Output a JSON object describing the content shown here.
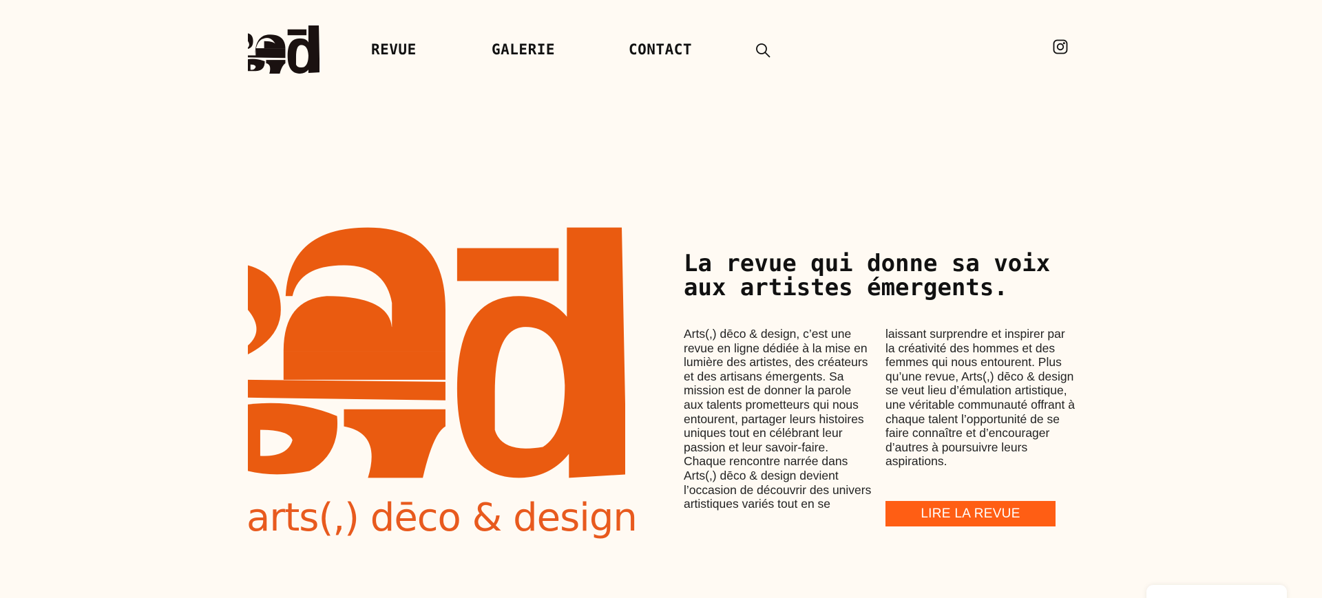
{
  "header": {
    "nav": [
      {
        "label": "REVUE"
      },
      {
        "label": "GALERIE"
      },
      {
        "label": "CONTACT"
      }
    ],
    "icons": {
      "search": "search-icon",
      "social": "instagram-icon"
    }
  },
  "hero": {
    "brand_name": "arts(,) dēco & design",
    "headline": "La revue qui donne sa voix aux artistes émergents.",
    "body_col1": "Arts(,) dēco & design, c’est une revue en ligne dédiée à la mise en lumière des artistes, des créateurs et des artisans émergents. Sa mission est de donner la parole aux talents prometteurs qui nous entourent, partager leurs histoires uniques tout en célébrant leur passion et leur savoir-faire. Chaque rencontre narrée dans Arts(,) dēco & design devient l’occasion de découvrir des univers artistiques variés tout en se",
    "body_col2": "laissant surprendre et inspirer par la créativité des hommes et des femmes qui nous entourent. Plus qu’une revue, Arts(,) dēco & design se veut lieu d’émulation artistique, une véritable communauté offrant à chaque talent l’opportunité de se faire connaître et d’encourager d’autres à poursuivre leurs aspirations.",
    "cta_label": "LIRE LA REVUE"
  },
  "colors": {
    "background": "#fffaf3",
    "brand_orange": "#e85a1e",
    "cta_orange": "#ff5e14",
    "logo_dark": "#1a1110"
  }
}
